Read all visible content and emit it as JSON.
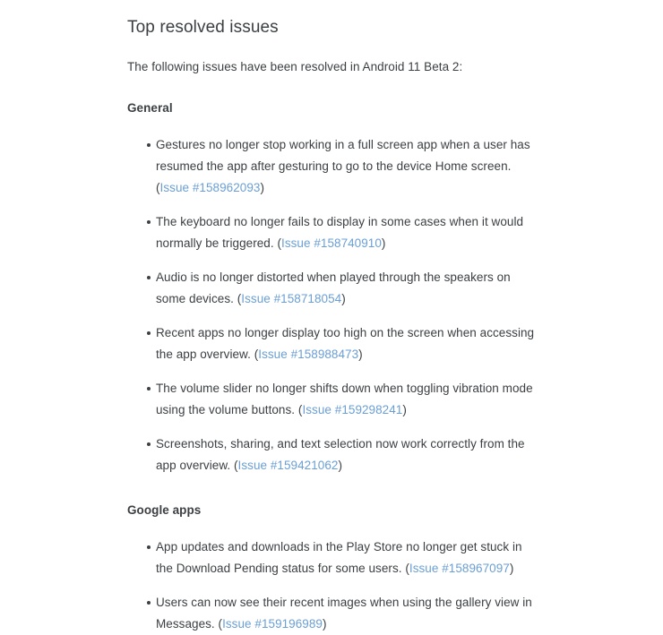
{
  "page": {
    "title": "Top resolved issues",
    "intro": "The following issues have been resolved in Android 11 Beta 2:",
    "link_color": "#6b9fd4",
    "text_color": "#3c4043",
    "background_color": "#ffffff"
  },
  "sections": [
    {
      "heading": "General",
      "items": [
        {
          "text": "Gestures no longer stop working in a full screen app when a user has resumed the app after gesturing to go to the device Home screen. ",
          "link": "Issue #158962093"
        },
        {
          "text": "The keyboard no longer fails to display in some cases when it would normally be triggered. ",
          "link": "Issue #158740910"
        },
        {
          "text": "Audio is no longer distorted when played through the speakers on some devices. ",
          "link": "Issue #158718054"
        },
        {
          "text": "Recent apps no longer display too high on the screen when accessing the app overview. ",
          "link": "Issue #158988473"
        },
        {
          "text": "The volume slider no longer shifts down when toggling vibration mode using the volume buttons. ",
          "link": "Issue #159298241"
        },
        {
          "text": "Screenshots, sharing, and text selection now work correctly from the app overview. ",
          "link": "Issue #159421062"
        }
      ]
    },
    {
      "heading": "Google apps",
      "items": [
        {
          "text": "App updates and downloads in the Play Store no longer get stuck in the Download Pending status for some users. ",
          "link": "Issue #158967097"
        },
        {
          "text": "Users can now see their recent images when using the gallery view in Messages. ",
          "link": "Issue #159196989"
        }
      ]
    }
  ],
  "punctuation": {
    "open_paren": "(",
    "close_paren": ")"
  }
}
